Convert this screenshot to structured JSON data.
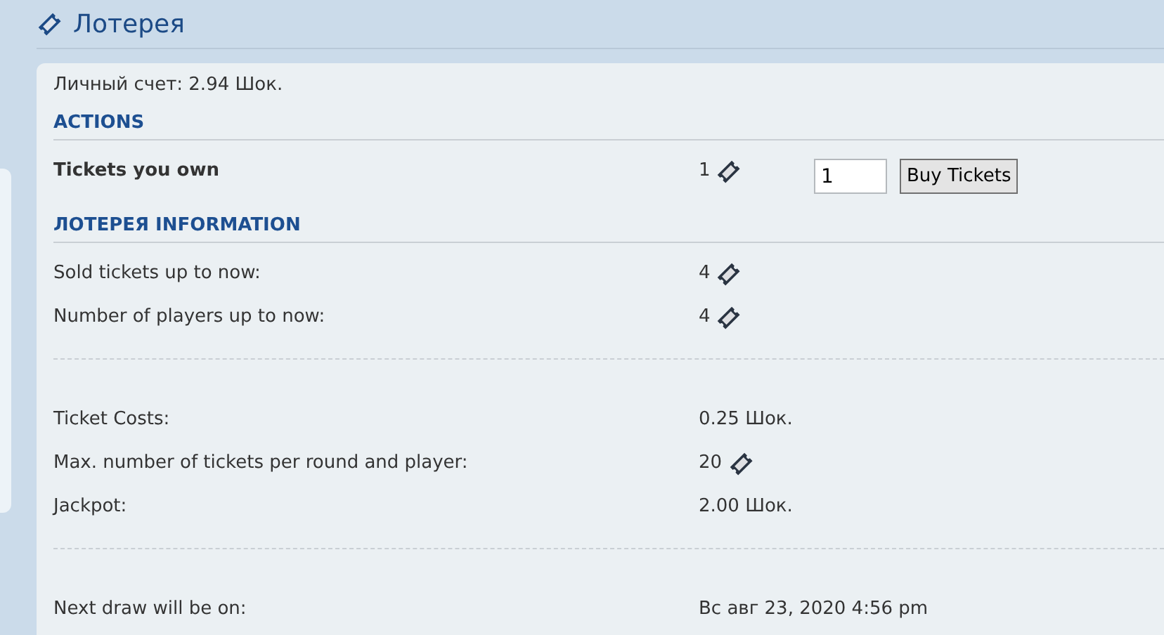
{
  "title": "Лотерея",
  "balance": "Личный счет: 2.94 Шок.",
  "actions": {
    "heading": "ACTIONS",
    "label": "Tickets you own",
    "value": "1",
    "ticket": true,
    "quantity": "1",
    "button": "Buy Tickets"
  },
  "information": {
    "heading": "ЛОТЕРЕЯ INFORMATION",
    "groups": [
      [
        {
          "label": "Sold tickets up to now:",
          "value": "4",
          "ticket": true
        },
        {
          "label": "Number of players up to now:",
          "value": "4",
          "ticket": true
        }
      ],
      [
        {
          "label": "Ticket Costs:",
          "value": "0.25 Шок.",
          "ticket": false
        },
        {
          "label": "Max. number of tickets per round and player:",
          "value": "20",
          "ticket": true
        },
        {
          "label": "Jackpot:",
          "value": "2.00 Шок.",
          "ticket": false
        }
      ],
      [
        {
          "label": "Next draw will be on:",
          "value": "Вс авг 23, 2020 4:56 pm",
          "ticket": false
        }
      ]
    ]
  }
}
